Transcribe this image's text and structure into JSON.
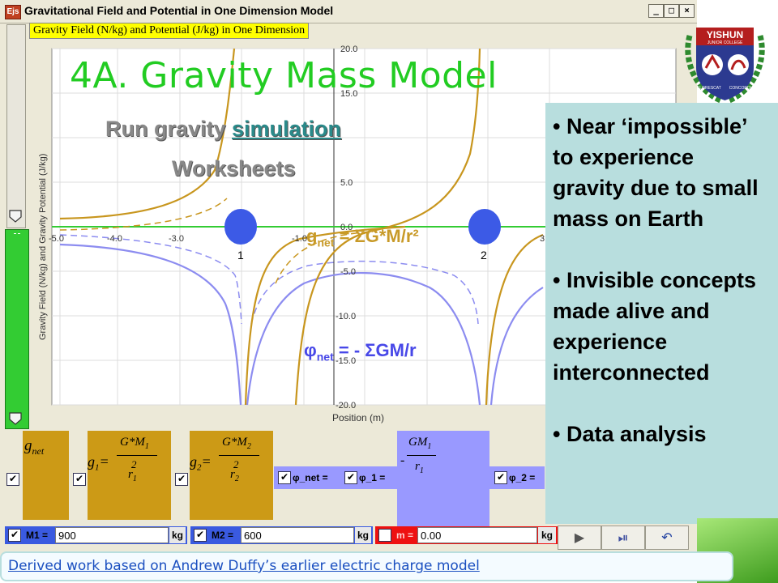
{
  "window": {
    "title": "Gravitational Field and Potential in One Dimension Model",
    "app_icon": "Ejs",
    "controls": {
      "minimize": "_",
      "maximize": "□",
      "close": "×"
    }
  },
  "plot": {
    "caption": "Gravity Field (N/kg) and Potential (J/kg) in One Dimension",
    "xlabel": "Position (m)",
    "ylabel": "Gravity Field (N/kg) and Gravity Potential (J/kg)",
    "x_ticks": [
      "-5.0",
      "-4.0",
      "-3.0",
      "-1.0",
      "3"
    ],
    "y_ticks": [
      "20.0",
      "15.0",
      "5.0",
      "0.0",
      "-5.0",
      "-10.0",
      "-15.0",
      "-20.0"
    ],
    "mass_labels": [
      "1",
      "2"
    ]
  },
  "slide": {
    "heading": "4A. Gravity Mass Model",
    "run_prefix": "Run gravity ",
    "run_link": "simulation",
    "worksheets": "Worksheets",
    "gnet_formula": "g",
    "gnet_sub": "net",
    "gnet_rest": " = ΣG*M/r²",
    "phinet_formula": "φ",
    "phinet_sub": "net",
    "phinet_rest": " = - ΣGM/r"
  },
  "bullets": [
    "• Near ‘impossible’ to experience gravity due to small mass on Earth",
    "• Invisible concepts made alive and experience interconnected",
    "• Data analysis"
  ],
  "logo": {
    "top": "YISHUN",
    "sub": "JUNIOR COLLEGE",
    "motto_left": "FLORESCAT",
    "motto_right": "CONCORDIA"
  },
  "equations": {
    "gnet": "g",
    "gnet_sub": "net",
    "g1_lhs": "g",
    "g1_sub": "1",
    "g1_num": "G*M",
    "g1_num_sub": "1",
    "g1_den": "r",
    "g1_den_sup": "2",
    "g1_den_sub": "1",
    "g2_lhs": "g",
    "g2_sub": "2",
    "g2_num": "G*M",
    "g2_num_sub": "2",
    "g2_den": "r",
    "g2_den_sup": "2",
    "g2_den_sub": "2",
    "phi_minus": "-",
    "phi_num": "GM",
    "phi_num_sub": "1",
    "phi_den": "r",
    "phi_den_sub": "1",
    "phi_net_label": "φ_net =",
    "phi1_label": "φ_1 =",
    "phi2_label": "φ_2 ="
  },
  "controls": {
    "m1_label": "M1 =",
    "m1_value": "900",
    "m1_unit": "kg",
    "m2_label": "M2 =",
    "m2_value": "600",
    "m2_unit": "kg",
    "m_label": "m =",
    "m_value": "0.00",
    "m_unit": "kg",
    "checkbox_mark": "✔"
  },
  "footer": {
    "link": "Derived work based on Andrew Duffy’s earlier electric charge model"
  },
  "colors": {
    "field_curve": "#c8961e",
    "potential_curve": "#8c8cf0",
    "mass_disc": "#3c5ae6",
    "heading_green": "#22cc22"
  }
}
